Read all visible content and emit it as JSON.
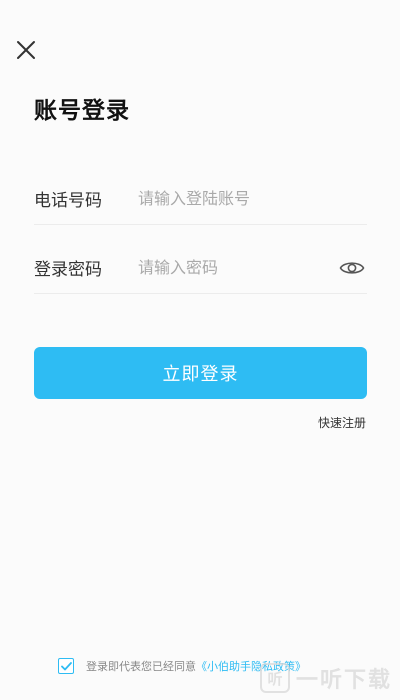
{
  "header": {
    "title": "账号登录"
  },
  "form": {
    "phone": {
      "label": "电话号码",
      "placeholder": "请输入登陆账号",
      "value": ""
    },
    "password": {
      "label": "登录密码",
      "placeholder": "请输入密码",
      "value": ""
    }
  },
  "actions": {
    "login_label": "立即登录",
    "register_label": "快速注册"
  },
  "agreement": {
    "checked": true,
    "text": "登录即代表您已经同意",
    "policy_link": "《小伯助手隐私政策》"
  },
  "watermark": {
    "logo": "听",
    "text": "一听下载"
  },
  "colors": {
    "accent": "#2ebcf3",
    "background": "#fbfbfb"
  },
  "icons": {
    "close": "close-icon",
    "eye": "eye-icon",
    "check": "check-icon"
  }
}
